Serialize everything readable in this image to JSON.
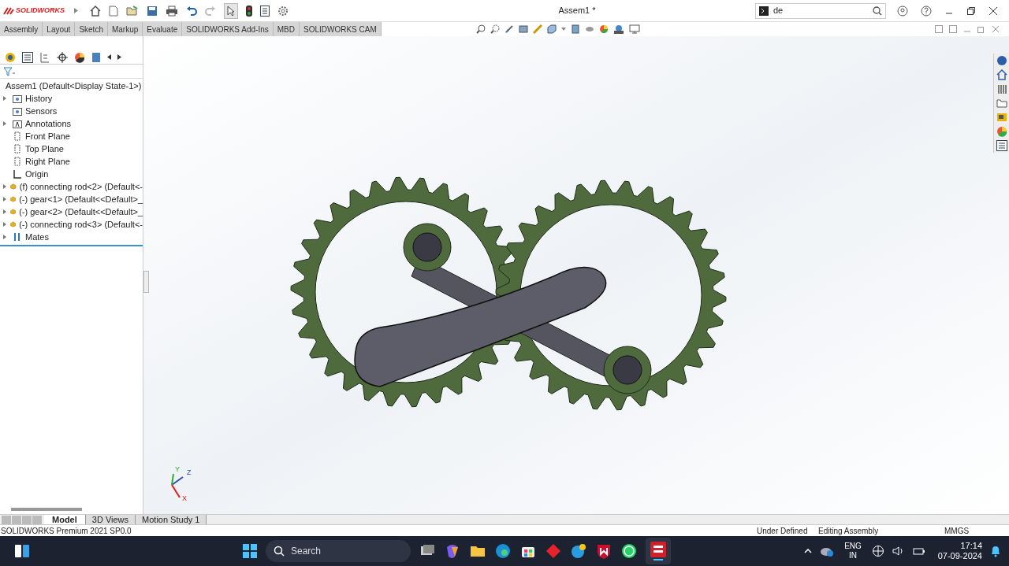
{
  "app": {
    "logo": "SOLIDWORKS",
    "document_title": "Assem1 *",
    "search": {
      "value": "de"
    }
  },
  "command_tabs": [
    {
      "label": "Assembly"
    },
    {
      "label": "Layout"
    },
    {
      "label": "Sketch"
    },
    {
      "label": "Markup"
    },
    {
      "label": "Evaluate"
    },
    {
      "label": "SOLIDWORKS Add-Ins"
    },
    {
      "label": "MBD"
    },
    {
      "label": "SOLIDWORKS CAM"
    }
  ],
  "feature_tree": {
    "root": "Assem1  (Default<Display State-1>)",
    "items": [
      {
        "label": "History",
        "kind": "folder",
        "expandable": true
      },
      {
        "label": "Sensors",
        "kind": "folder",
        "expandable": false
      },
      {
        "label": "Annotations",
        "kind": "annotations",
        "expandable": true
      },
      {
        "label": "Front Plane",
        "kind": "plane",
        "expandable": false
      },
      {
        "label": "Top Plane",
        "kind": "plane",
        "expandable": false
      },
      {
        "label": "Right Plane",
        "kind": "plane",
        "expandable": false
      },
      {
        "label": "Origin",
        "kind": "origin",
        "expandable": false
      },
      {
        "label": "(f) connecting rod<2> (Default<-",
        "kind": "part",
        "expandable": true
      },
      {
        "label": "(-) gear<1> (Default<<Default>_",
        "kind": "part",
        "expandable": true
      },
      {
        "label": "(-) gear<2> (Default<<Default>_",
        "kind": "part",
        "expandable": true
      },
      {
        "label": "(-) connecting rod<3> (Default<-",
        "kind": "part",
        "expandable": true
      },
      {
        "label": "Mates",
        "kind": "mates",
        "expandable": true
      }
    ]
  },
  "triad": [
    "Z",
    "Y",
    "X"
  ],
  "bottom_tabs": [
    {
      "label": "Model",
      "selected": true
    },
    {
      "label": "3D Views",
      "selected": false
    },
    {
      "label": "Motion Study 1",
      "selected": false
    }
  ],
  "status_bar": {
    "product": "SOLIDWORKS Premium 2021 SP0.0",
    "state": "Under Defined",
    "mode": "Editing Assembly",
    "units": "MMGS"
  },
  "taskbar": {
    "search_placeholder": "Search",
    "language": "ENG",
    "region": "IN",
    "time": "17:14",
    "date": "07-09-2024"
  }
}
